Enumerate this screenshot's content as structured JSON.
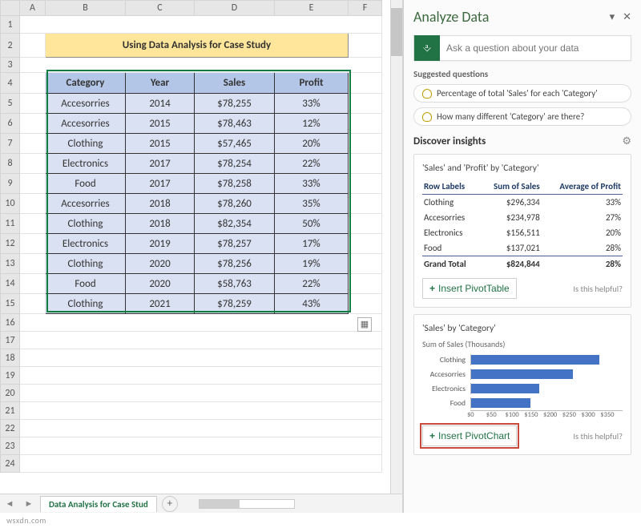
{
  "sheet": {
    "columns": [
      "A",
      "B",
      "C",
      "D",
      "E",
      "F"
    ],
    "title": "Using Data Analysis for Case Study",
    "headers": {
      "category": "Category",
      "year": "Year",
      "sales": "Sales",
      "profit": "Profit"
    },
    "rows": [
      {
        "category": "Accesorries",
        "year": "2014",
        "sales": "$78,255",
        "profit": "33%"
      },
      {
        "category": "Accesorries",
        "year": "2015",
        "sales": "$78,463",
        "profit": "12%"
      },
      {
        "category": "Clothing",
        "year": "2015",
        "sales": "$57,465",
        "profit": "20%"
      },
      {
        "category": "Electronics",
        "year": "2017",
        "sales": "$78,254",
        "profit": "22%"
      },
      {
        "category": "Food",
        "year": "2017",
        "sales": "$78,258",
        "profit": "33%"
      },
      {
        "category": "Accesorries",
        "year": "2018",
        "sales": "$78,260",
        "profit": "35%"
      },
      {
        "category": "Clothing",
        "year": "2018",
        "sales": "$82,354",
        "profit": "50%"
      },
      {
        "category": "Electronics",
        "year": "2019",
        "sales": "$78,257",
        "profit": "17%"
      },
      {
        "category": "Clothing",
        "year": "2020",
        "sales": "$78,256",
        "profit": "19%"
      },
      {
        "category": "Food",
        "year": "2020",
        "sales": "$58,763",
        "profit": "22%"
      },
      {
        "category": "Clothing",
        "year": "2021",
        "sales": "$78,259",
        "profit": "43%"
      }
    ],
    "tab_label": "Data Analysis for Case Stud"
  },
  "pane": {
    "title": "Analyze Data",
    "ask_placeholder": "Ask a question about your data",
    "suggested_label": "Suggested questions",
    "suggestions": [
      "Percentage of total 'Sales' for each 'Category'",
      "How many different 'Category' are there?"
    ],
    "discover_label": "Discover insights",
    "card1": {
      "title": "'Sales' and 'Profit' by 'Category'",
      "headers": {
        "row": "Row Labels",
        "sales": "Sum of Sales",
        "profit": "Average of Profit"
      },
      "rows": [
        {
          "label": "Clothing",
          "sales": "$296,334",
          "profit": "33%"
        },
        {
          "label": "Accesorries",
          "sales": "$234,978",
          "profit": "27%"
        },
        {
          "label": "Electronics",
          "sales": "$156,511",
          "profit": "20%"
        },
        {
          "label": "Food",
          "sales": "$137,021",
          "profit": "28%"
        }
      ],
      "grand": {
        "label": "Grand Total",
        "sales": "$824,844",
        "profit": "28%"
      },
      "insert_label": "Insert PivotTable",
      "helpful": "Is this helpful?"
    },
    "card2": {
      "title": "'Sales' by 'Category'",
      "subtitle": "Sum of Sales (Thousands)",
      "insert_label": "Insert PivotChart",
      "helpful": "Is this helpful?"
    }
  },
  "chart_data": {
    "type": "bar",
    "categories": [
      "Clothing",
      "Accesorries",
      "Electronics",
      "Food"
    ],
    "values": [
      296,
      235,
      157,
      137
    ],
    "title": "'Sales' by 'Category'",
    "xlabel": "Sum of Sales (Thousands)",
    "ylabel": "",
    "xlim": [
      0,
      350
    ],
    "ticks": [
      "$0",
      "$50",
      "$100",
      "$150",
      "$200",
      "$250",
      "$300",
      "$350"
    ]
  },
  "watermark": "wsxdn.com"
}
